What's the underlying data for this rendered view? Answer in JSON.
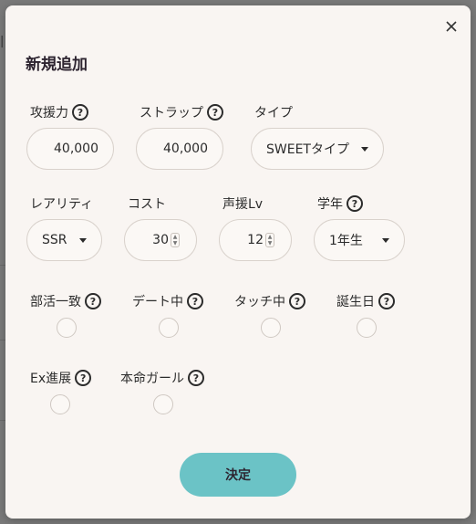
{
  "modal": {
    "title": "新規追加",
    "submit_label": "決定"
  },
  "row1": {
    "support_power": {
      "label": "攻援力",
      "value": "40,000"
    },
    "strap": {
      "label": "ストラップ",
      "value": "40,000"
    },
    "type": {
      "label": "タイプ",
      "value": "SWEETタイプ"
    }
  },
  "row2": {
    "rarity": {
      "label": "レアリティ",
      "value": "SSR"
    },
    "cost": {
      "label": "コスト",
      "value": "30"
    },
    "voice_lv": {
      "label": "声援Lv",
      "value": "12"
    },
    "grade": {
      "label": "学年",
      "value": "1年生"
    }
  },
  "row3": {
    "club_match": {
      "label": "部活一致",
      "checked": false
    },
    "dating": {
      "label": "デート中",
      "checked": false
    },
    "touching": {
      "label": "タッチ中",
      "checked": false
    },
    "birthday": {
      "label": "誕生日",
      "checked": false
    }
  },
  "row4": {
    "ex_progress": {
      "label": "Ex進展",
      "checked": false
    },
    "true_love_girl": {
      "label": "本命ガール",
      "checked": false
    }
  },
  "icons": {
    "help": "?",
    "close": "close-icon"
  },
  "colors": {
    "accent": "#6bc3c6",
    "background": "#f9f5f2",
    "overlay": "#7a7a7a"
  }
}
